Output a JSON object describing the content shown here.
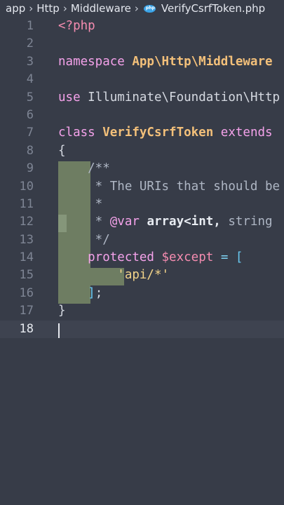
{
  "breadcrumb": {
    "items": [
      "app",
      "Http",
      "Middleware"
    ],
    "file_name": "VerifyCsrfToken.php"
  },
  "editor": {
    "current_line": "18",
    "lines": [
      {
        "number": "1",
        "segments": [
          {
            "text": "<?php",
            "style": "tag"
          }
        ]
      },
      {
        "number": "2",
        "segments": []
      },
      {
        "number": "3",
        "segments": [
          {
            "text": "namespace ",
            "style": "kw"
          },
          {
            "text": "App\\Http\\Middleware",
            "style": "ns"
          }
        ]
      },
      {
        "number": "4",
        "segments": []
      },
      {
        "number": "5",
        "segments": [
          {
            "text": "use ",
            "style": "kw"
          },
          {
            "text": "Illuminate\\Foundation\\Http",
            "style": "plain"
          }
        ]
      },
      {
        "number": "6",
        "segments": []
      },
      {
        "number": "7",
        "segments": [
          {
            "text": "class ",
            "style": "kw"
          },
          {
            "text": "VerifyCsrfToken ",
            "style": "cls"
          },
          {
            "text": "extends",
            "style": "kw"
          }
        ]
      },
      {
        "number": "8",
        "segments": [
          {
            "text": "{",
            "style": "punct"
          }
        ]
      },
      {
        "number": "9",
        "segments": [
          {
            "text": "    /**",
            "style": "cmt"
          }
        ]
      },
      {
        "number": "10",
        "segments": [
          {
            "text": "     * The URIs that should be",
            "style": "cmt"
          }
        ]
      },
      {
        "number": "11",
        "segments": [
          {
            "text": "     *",
            "style": "cmt"
          }
        ]
      },
      {
        "number": "12",
        "segments": [
          {
            "text": "     * ",
            "style": "cmt"
          },
          {
            "text": "@var ",
            "style": "doc"
          },
          {
            "text": "array<int, ",
            "style": "type"
          },
          {
            "text": "string",
            "style": "cmt"
          }
        ]
      },
      {
        "number": "13",
        "segments": [
          {
            "text": "     */",
            "style": "cmt"
          }
        ]
      },
      {
        "number": "14",
        "segments": [
          {
            "text": "    protected ",
            "style": "kw"
          },
          {
            "text": "$except ",
            "style": "var"
          },
          {
            "text": "= ",
            "style": "op"
          },
          {
            "text": "[",
            "style": "brk"
          }
        ]
      },
      {
        "number": "15",
        "segments": [
          {
            "text": "        'api/*'",
            "style": "str"
          }
        ]
      },
      {
        "number": "16",
        "segments": [
          {
            "text": "    ]",
            "style": "brk"
          },
          {
            "text": ";",
            "style": "punct"
          }
        ]
      },
      {
        "number": "17",
        "segments": [
          {
            "text": "}",
            "style": "punct"
          }
        ]
      },
      {
        "number": "18",
        "segments": []
      }
    ]
  },
  "colors": {
    "background": "#373c48",
    "indent_highlight": "#6e7d62",
    "keyword": "#f4a2ea",
    "class_name": "#f3c07a",
    "string": "#f3d48a",
    "variable": "#f58cb0"
  }
}
